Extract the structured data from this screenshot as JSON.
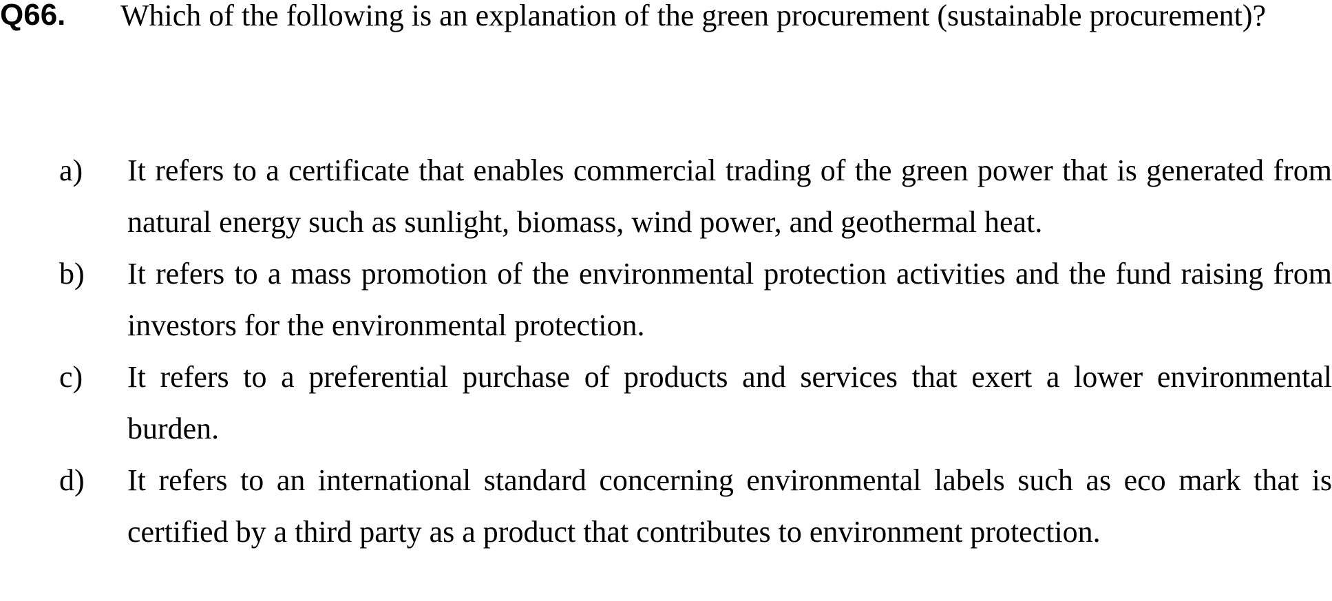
{
  "question": {
    "number": "Q66.",
    "text": "Which of the following is an explanation of the green procurement (sustainable procurement)?"
  },
  "options": [
    {
      "letter": "a)",
      "text": "It refers to a certificate that enables commercial trading of the green power that is generated from natural energy such as sunlight, biomass, wind power, and geothermal heat."
    },
    {
      "letter": "b)",
      "text": "It refers to a mass promotion of the environmental protection activities and the fund raising from investors for the environmental protection."
    },
    {
      "letter": "c)",
      "text": "It refers to a preferential purchase of products and services that exert a lower environmental burden."
    },
    {
      "letter": "d)",
      "text": "It refers to an international standard concerning environmental labels such as eco mark that is certified by a third party as a product that contributes to environment protection."
    }
  ]
}
